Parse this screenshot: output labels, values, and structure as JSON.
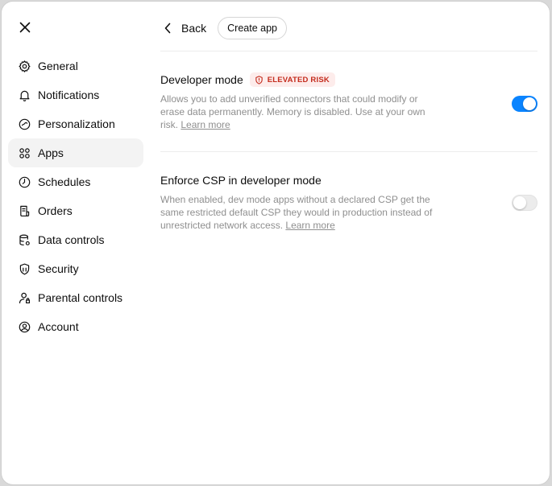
{
  "close": {
    "icon": "close-icon"
  },
  "header": {
    "back_label": "Back",
    "create_label": "Create app"
  },
  "sidebar": {
    "items": [
      {
        "label": "General",
        "icon": "gear-icon"
      },
      {
        "label": "Notifications",
        "icon": "bell-icon"
      },
      {
        "label": "Personalization",
        "icon": "personalization-icon"
      },
      {
        "label": "Apps",
        "icon": "apps-grid-icon",
        "active": true
      },
      {
        "label": "Schedules",
        "icon": "clock-icon"
      },
      {
        "label": "Orders",
        "icon": "receipt-icon"
      },
      {
        "label": "Data controls",
        "icon": "database-icon"
      },
      {
        "label": "Security",
        "icon": "shield-icon"
      },
      {
        "label": "Parental controls",
        "icon": "parental-icon"
      },
      {
        "label": "Account",
        "icon": "account-icon"
      }
    ]
  },
  "settings": {
    "developer_mode": {
      "title": "Developer mode",
      "badge": "ELEVATED RISK",
      "description": "Allows you to add unverified connectors that could modify or erase data permanently. Memory is disabled. Use at your own risk.",
      "link": "Learn more",
      "enabled": true
    },
    "enforce_csp": {
      "title": "Enforce CSP in developer mode",
      "description": "When enabled, dev mode apps without a declared CSP get the same restricted default CSP they would in production instead of unrestricted network access.",
      "link": "Learn more",
      "enabled": false
    }
  },
  "colors": {
    "accent": "#0a84ff",
    "risk": "#c42b1c",
    "risk_bg": "#fdeceb"
  }
}
